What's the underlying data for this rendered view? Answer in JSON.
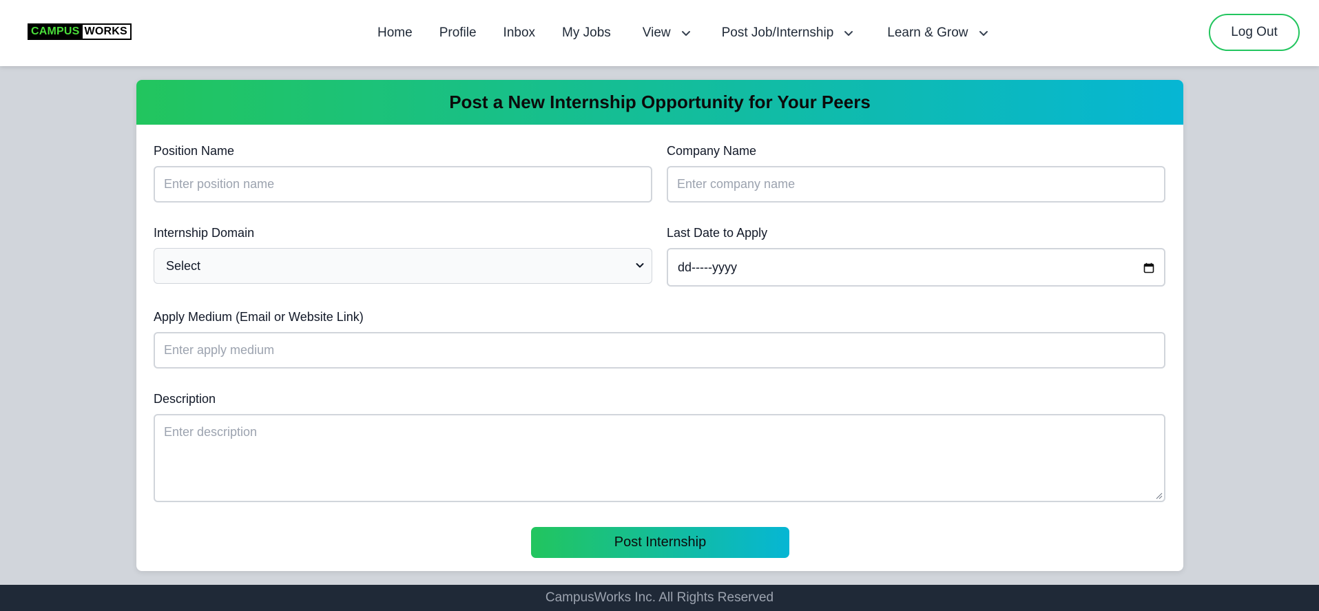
{
  "brand": {
    "part1": "CAMPUS",
    "part2": "WORKS"
  },
  "nav": {
    "home": "Home",
    "profile": "Profile",
    "inbox": "Inbox",
    "my_jobs": "My Jobs",
    "view": "View",
    "post_job": "Post Job/Internship",
    "learn_grow": "Learn & Grow",
    "dropdown_icon": "chevron-down-icon"
  },
  "logout_label": "Log Out",
  "form": {
    "title": "Post a New Internship Opportunity for Your Peers",
    "position": {
      "label": "Position Name",
      "placeholder": "Enter position name",
      "value": ""
    },
    "company": {
      "label": "Company Name",
      "placeholder": "Enter company name",
      "value": ""
    },
    "domain": {
      "label": "Internship Domain",
      "selected": "Select"
    },
    "last_date": {
      "label": "Last Date to Apply",
      "placeholder": "dd-----yyyy"
    },
    "apply_medium": {
      "label": "Apply Medium (Email or Website Link)",
      "placeholder": "Enter apply medium",
      "value": ""
    },
    "description": {
      "label": "Description",
      "placeholder": "Enter description",
      "value": ""
    },
    "submit_label": "Post Internship"
  },
  "footer": {
    "text": "CampusWorks Inc. All Rights Reserved"
  },
  "colors": {
    "accent_green": "#22c55e",
    "accent_cyan": "#06b6d4",
    "page_bg": "#d1d5db",
    "footer_bg": "#1f2937"
  }
}
